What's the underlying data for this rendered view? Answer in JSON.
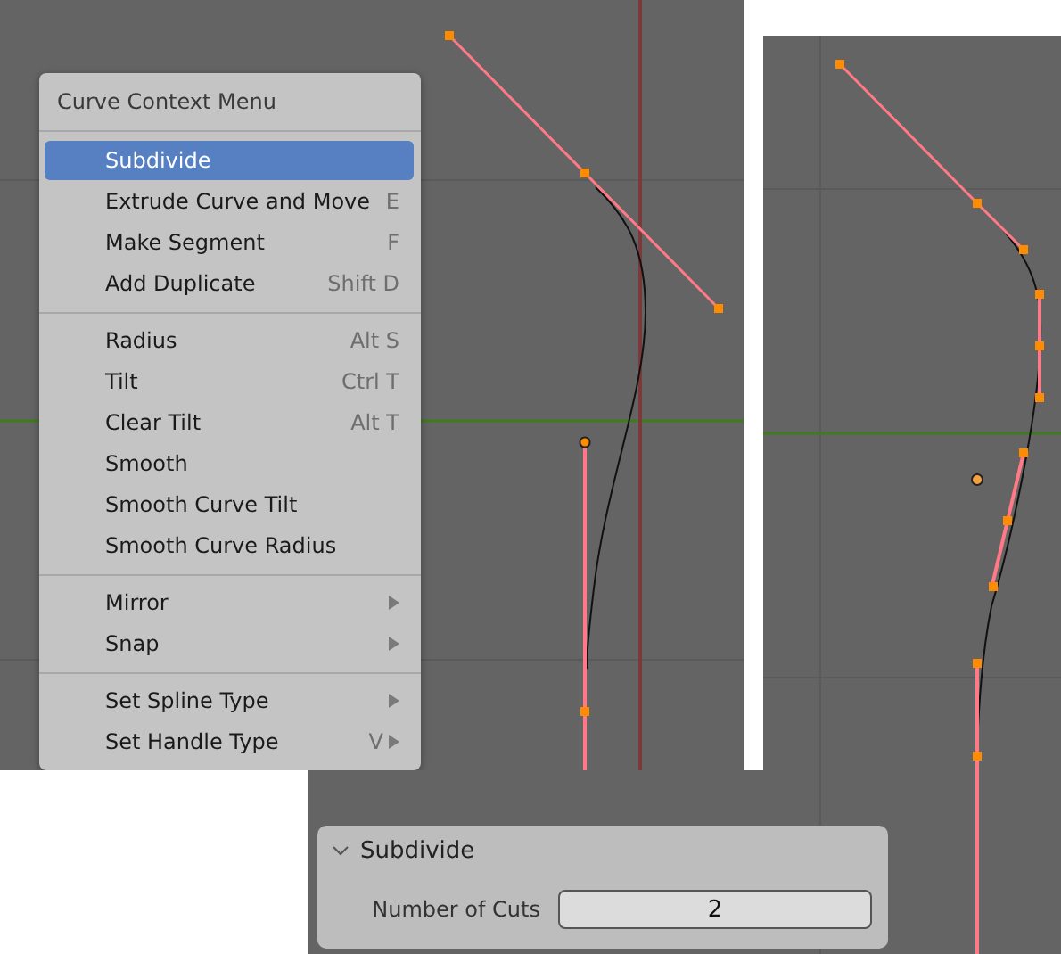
{
  "context_menu": {
    "title": "Curve Context Menu",
    "sections": [
      [
        {
          "label": "Subdivide",
          "selected": true
        },
        {
          "label": "Extrude Curve and Move",
          "shortcut": "E",
          "selected": false
        },
        {
          "label": "Make Segment",
          "shortcut": "F",
          "selected": false
        },
        {
          "label": "Add Duplicate",
          "shortcut": "Shift D",
          "selected": false
        }
      ],
      [
        {
          "label": "Radius",
          "shortcut": "Alt S",
          "selected": false
        },
        {
          "label": "Tilt",
          "shortcut": "Ctrl T",
          "selected": false
        },
        {
          "label": "Clear Tilt",
          "shortcut": "Alt T",
          "selected": false
        },
        {
          "label": "Smooth",
          "selected": false
        },
        {
          "label": "Smooth Curve Tilt",
          "selected": false
        },
        {
          "label": "Smooth Curve Radius",
          "selected": false
        }
      ],
      [
        {
          "label": "Mirror",
          "submenu": true,
          "selected": false
        },
        {
          "label": "Snap",
          "submenu": true,
          "selected": false
        }
      ],
      [
        {
          "label": "Set Spline Type",
          "submenu": true,
          "selected": false
        },
        {
          "label": "Set Handle Type",
          "shortcut": "V",
          "submenu": true,
          "selected": false
        }
      ]
    ]
  },
  "redo_panel": {
    "title": "Subdivide",
    "expanded": true,
    "fields": [
      {
        "label": "Number of Cuts",
        "value": "2"
      }
    ]
  }
}
